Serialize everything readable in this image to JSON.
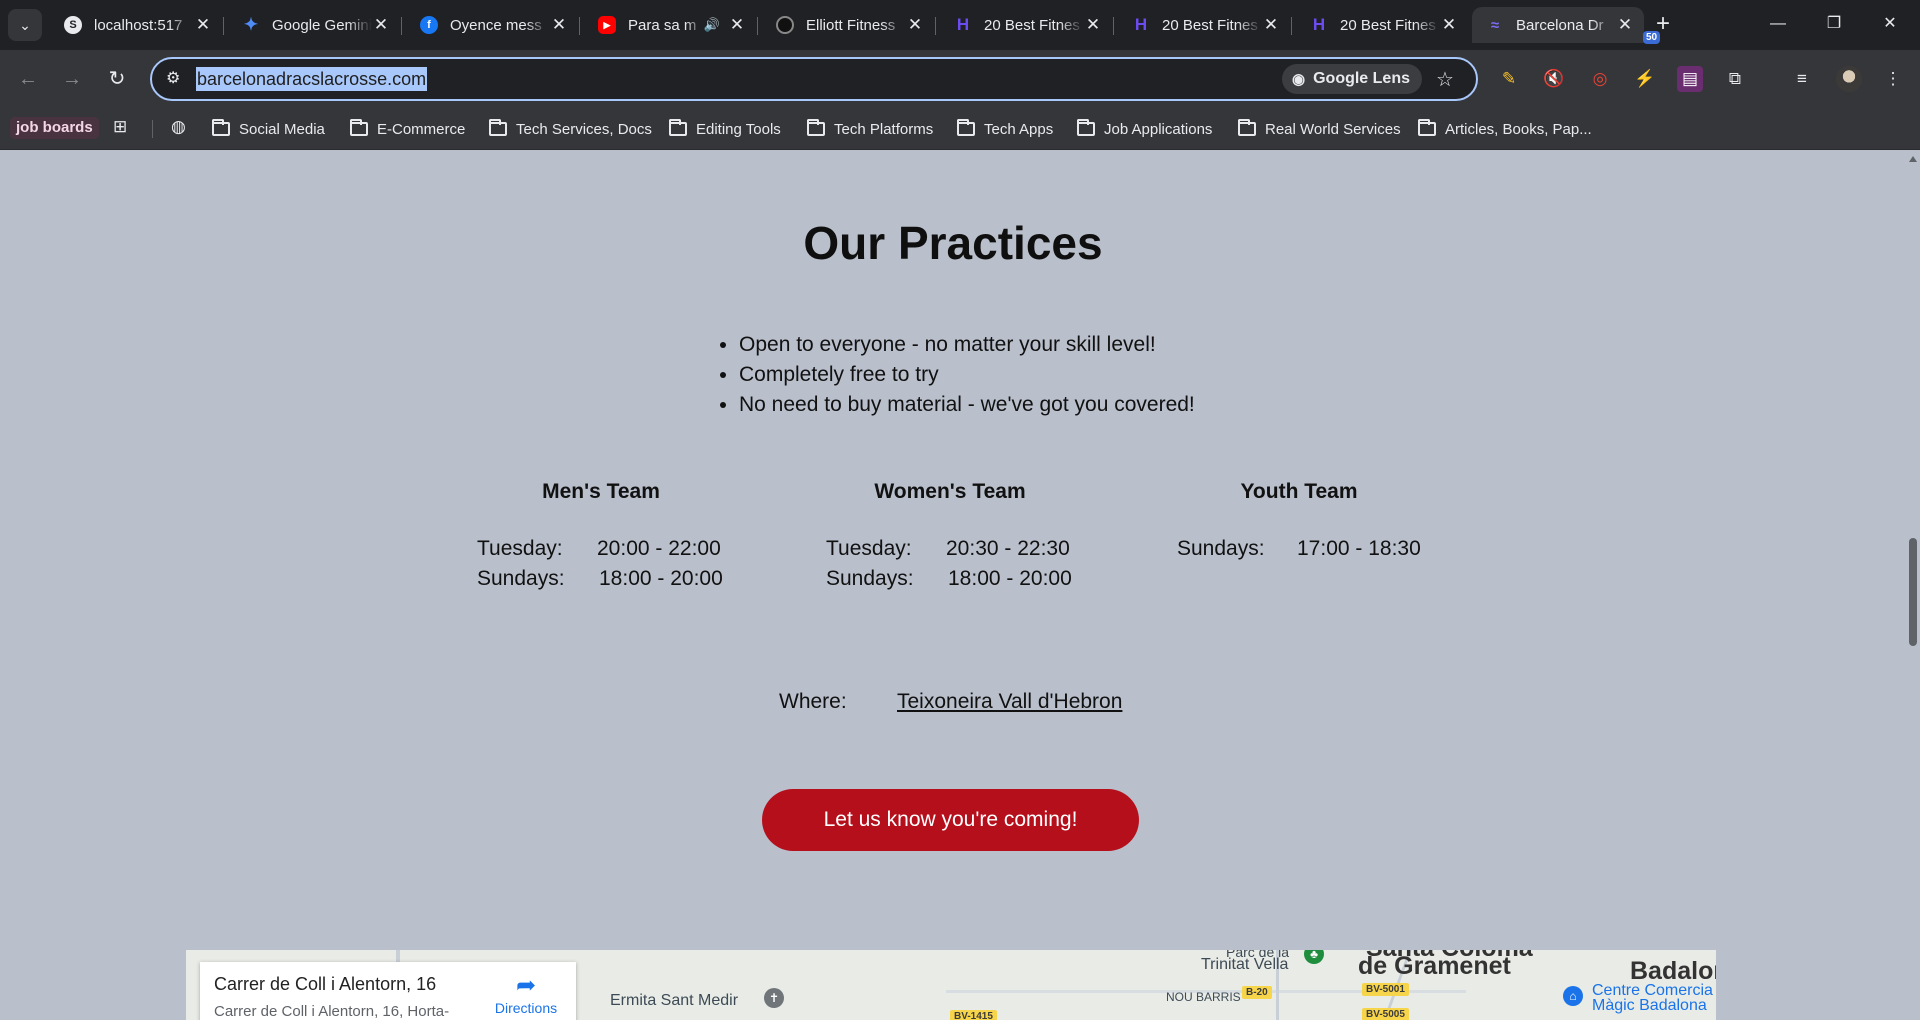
{
  "browser": {
    "tabs": [
      {
        "title": "localhost:517",
        "favicon_color": "#e8eaed"
      },
      {
        "title": "Google Gemini",
        "favicon_color": "#4f8cf7"
      },
      {
        "title": "Oyence mess",
        "favicon_color": "#1877f2"
      },
      {
        "title": "Para sa m",
        "favicon_color": "#ff0000"
      },
      {
        "title": "Elliott Fitness",
        "favicon_color": "#111111"
      },
      {
        "title": "20 Best Fitnes",
        "favicon_color": "#6c4cf0"
      },
      {
        "title": "20 Best Fitnes",
        "favicon_color": "#6c4cf0"
      },
      {
        "title": "20 Best Fitnes",
        "favicon_color": "#6c4cf0"
      },
      {
        "title": "Barcelona Dr",
        "favicon_color": "#7b6cf0"
      }
    ],
    "url": "barcelonadracslacrosse.com",
    "lens_label": "Google Lens",
    "extension_badge": "50",
    "bookmarks_chip": "job boards",
    "bookmarks": [
      "Social Media",
      "E-Commerce",
      "Tech Services, Docs",
      "Editing Tools",
      "Tech Platforms",
      "Tech Apps",
      "Job Applications",
      "Real World Services",
      "Articles, Books, Pap..."
    ]
  },
  "page": {
    "heading": "Our Practices",
    "perks": [
      "Open to everyone - no matter your skill level!",
      "Completely free to try",
      "No need to buy material - we've got you covered!"
    ],
    "teams": [
      {
        "name": "Men's Team",
        "schedule": [
          {
            "day": "Tuesday:",
            "time": "20:00 - 22:00"
          },
          {
            "day": "Sundays:",
            "time": "18:00 - 20:00"
          }
        ]
      },
      {
        "name": "Women's Team",
        "schedule": [
          {
            "day": "Tuesday:",
            "time": "20:30 - 22:30"
          },
          {
            "day": "Sundays:",
            "time": "18:00 - 20:00"
          }
        ]
      },
      {
        "name": "Youth Team",
        "schedule": [
          {
            "day": "Sundays:",
            "time": "17:00 - 18:30"
          }
        ]
      }
    ],
    "where_label": "Where:",
    "where_link": "Teixoneira Vall d'Hebron",
    "cta_label": "Let us know you're coming!",
    "cta_color": "#b50f1c",
    "background_color": "#b9bfcb"
  },
  "map": {
    "card_title": "Carrer de Coll i Alentorn, 16",
    "card_subtitle": "Carrer de Coll i Alentorn, 16, Horta-",
    "directions_label": "Directions",
    "labels": {
      "ermita": "Ermita Sant Medir",
      "trinitat": "Trinitat Vella",
      "parc": "Parc de la",
      "santa_coloma": "Santa Coloma",
      "gramenet": "de Gramenet",
      "badalona": "Badalon",
      "nou_barris": "NOU BARRIS",
      "centre": "Centre Comercia",
      "magic": "Màgic Badalona"
    },
    "shields": {
      "bv1415": "BV-1415",
      "b20": "B-20",
      "bv5001": "BV-5001",
      "bv5005": "BV-5005"
    }
  }
}
